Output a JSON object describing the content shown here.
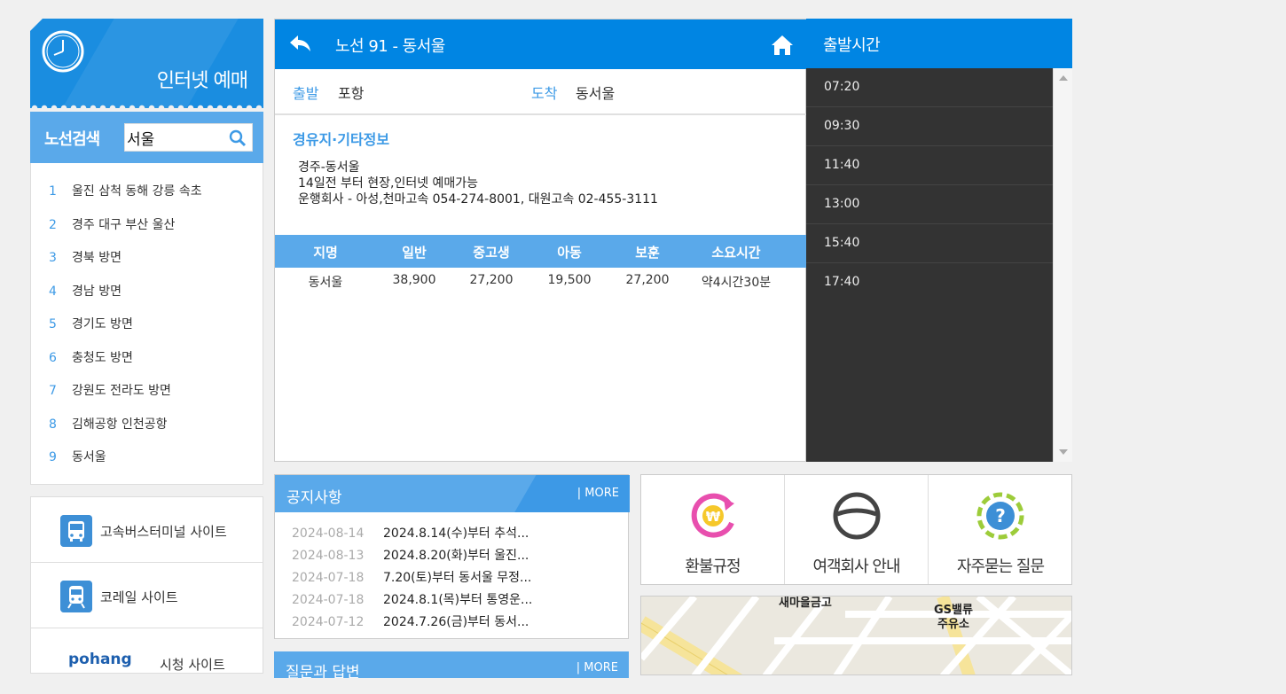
{
  "banner": {
    "title": "인터넷 예매"
  },
  "search": {
    "label": "노선검색",
    "value": "서울"
  },
  "route_list": [
    {
      "num": "1",
      "label": "울진 삼척 동해 강릉 속초"
    },
    {
      "num": "2",
      "label": "경주 대구 부산 울산"
    },
    {
      "num": "3",
      "label": "경북 방면"
    },
    {
      "num": "4",
      "label": "경남 방면"
    },
    {
      "num": "5",
      "label": "경기도 방면"
    },
    {
      "num": "6",
      "label": "충청도 방면"
    },
    {
      "num": "7",
      "label": "강원도 전라도 방면"
    },
    {
      "num": "8",
      "label": "김해공항 인천공항"
    },
    {
      "num": "9",
      "label": "동서울"
    }
  ],
  "links": [
    {
      "label": "고속버스터미널 사이트",
      "icon": "bus-icon"
    },
    {
      "label": "코레일 사이트",
      "icon": "train-icon"
    },
    {
      "label": "시청 사이트",
      "logo_text": "pohang"
    }
  ],
  "route": {
    "title": "노선 91 - 동서울",
    "departure_label": "출발",
    "departure": "포항",
    "arrival_label": "도착",
    "arrival": "동서울",
    "via_heading": "경유지·기타정보",
    "info_lines": [
      "경주-동서울",
      "14일전 부터 현장,인터넷 예매가능",
      "운행회사 - 아성,천마고속 054-274-8001, 대원고속 02-455-3111"
    ]
  },
  "fare_table": {
    "headers": [
      "지명",
      "일반",
      "중고생",
      "아동",
      "보훈",
      "소요시간"
    ],
    "rows": [
      [
        "동서울",
        "38,900",
        "27,200",
        "19,500",
        "27,200",
        "약4시간30분"
      ]
    ]
  },
  "departures": {
    "title": "출발시간",
    "times": [
      "07:20",
      "09:30",
      "11:40",
      "13:00",
      "15:40",
      "17:40"
    ]
  },
  "notices": {
    "title": "공지사항",
    "more": "| MORE",
    "items": [
      {
        "date": "2024-08-14",
        "subject": "2024.8.14(수)부터 추석..."
      },
      {
        "date": "2024-08-13",
        "subject": "2024.8.20(화)부터 울진..."
      },
      {
        "date": "2024-07-18",
        "subject": "7.20(토)부터 동서울 무정..."
      },
      {
        "date": "2024-07-18",
        "subject": "2024.8.1(목)부터 통영운..."
      },
      {
        "date": "2024-07-12",
        "subject": "2024.7.26(금)부터 동서..."
      }
    ]
  },
  "qa": {
    "title": "질문과 답변",
    "more": "| MORE"
  },
  "quick_links": [
    {
      "label": "환불규정",
      "icon": "refund-icon"
    },
    {
      "label": "여객회사 안내",
      "icon": "steering-wheel-icon"
    },
    {
      "label": "자주묻는 질문",
      "icon": "question-icon"
    }
  ],
  "map": {
    "labels": [
      "새마을금고",
      "GS밸류\n주유소"
    ]
  },
  "colors": {
    "primary": "#0085e3",
    "secondary": "#5aa9ea",
    "dark": "#333333",
    "accent_text": "#3d9ae6"
  }
}
